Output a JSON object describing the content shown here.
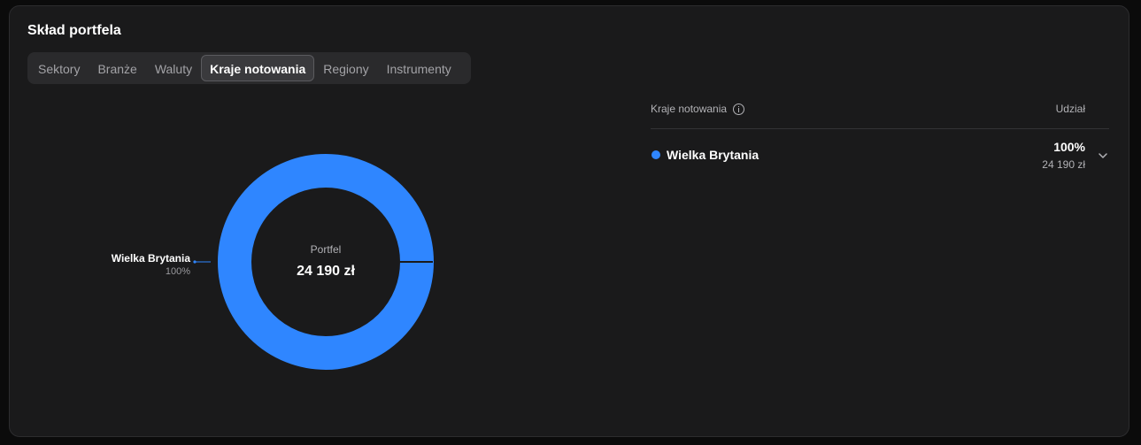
{
  "panel": {
    "title": "Skład portfela",
    "tabs": [
      {
        "label": "Sektory",
        "active": false
      },
      {
        "label": "Branże",
        "active": false
      },
      {
        "label": "Waluty",
        "active": false
      },
      {
        "label": "Kraje notowania",
        "active": true
      },
      {
        "label": "Regiony",
        "active": false
      },
      {
        "label": "Instrumenty",
        "active": false
      }
    ]
  },
  "chart_data": {
    "type": "pie",
    "center_label": "Portfel",
    "center_value": "24 190 zł",
    "slices": [
      {
        "name": "Wielka Brytania",
        "value": 100,
        "label": "100%",
        "color": "#2f86ff"
      }
    ]
  },
  "table": {
    "header_name": "Kraje notowania",
    "header_share": "Udział",
    "info_icon": "info-icon",
    "rows": [
      {
        "name": "Wielka Brytania",
        "percent": "100%",
        "amount": "24 190 zł",
        "color": "#2f86ff",
        "icon": "chevron-down-icon"
      }
    ]
  }
}
